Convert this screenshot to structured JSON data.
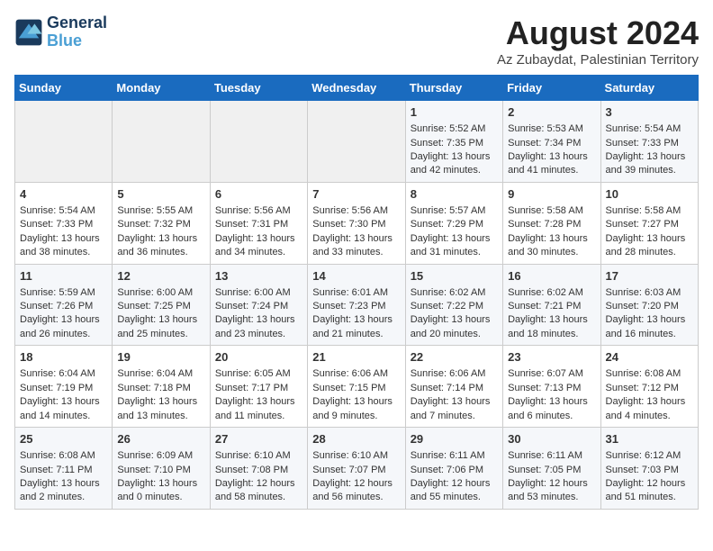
{
  "logo": {
    "line1": "General",
    "line2": "Blue"
  },
  "title": "August 2024",
  "subtitle": "Az Zubaydat, Palestinian Territory",
  "days_of_week": [
    "Sunday",
    "Monday",
    "Tuesday",
    "Wednesday",
    "Thursday",
    "Friday",
    "Saturday"
  ],
  "weeks": [
    [
      {
        "day": "",
        "content": ""
      },
      {
        "day": "",
        "content": ""
      },
      {
        "day": "",
        "content": ""
      },
      {
        "day": "",
        "content": ""
      },
      {
        "day": "1",
        "content": "Sunrise: 5:52 AM\nSunset: 7:35 PM\nDaylight: 13 hours\nand 42 minutes."
      },
      {
        "day": "2",
        "content": "Sunrise: 5:53 AM\nSunset: 7:34 PM\nDaylight: 13 hours\nand 41 minutes."
      },
      {
        "day": "3",
        "content": "Sunrise: 5:54 AM\nSunset: 7:33 PM\nDaylight: 13 hours\nand 39 minutes."
      }
    ],
    [
      {
        "day": "4",
        "content": "Sunrise: 5:54 AM\nSunset: 7:33 PM\nDaylight: 13 hours\nand 38 minutes."
      },
      {
        "day": "5",
        "content": "Sunrise: 5:55 AM\nSunset: 7:32 PM\nDaylight: 13 hours\nand 36 minutes."
      },
      {
        "day": "6",
        "content": "Sunrise: 5:56 AM\nSunset: 7:31 PM\nDaylight: 13 hours\nand 34 minutes."
      },
      {
        "day": "7",
        "content": "Sunrise: 5:56 AM\nSunset: 7:30 PM\nDaylight: 13 hours\nand 33 minutes."
      },
      {
        "day": "8",
        "content": "Sunrise: 5:57 AM\nSunset: 7:29 PM\nDaylight: 13 hours\nand 31 minutes."
      },
      {
        "day": "9",
        "content": "Sunrise: 5:58 AM\nSunset: 7:28 PM\nDaylight: 13 hours\nand 30 minutes."
      },
      {
        "day": "10",
        "content": "Sunrise: 5:58 AM\nSunset: 7:27 PM\nDaylight: 13 hours\nand 28 minutes."
      }
    ],
    [
      {
        "day": "11",
        "content": "Sunrise: 5:59 AM\nSunset: 7:26 PM\nDaylight: 13 hours\nand 26 minutes."
      },
      {
        "day": "12",
        "content": "Sunrise: 6:00 AM\nSunset: 7:25 PM\nDaylight: 13 hours\nand 25 minutes."
      },
      {
        "day": "13",
        "content": "Sunrise: 6:00 AM\nSunset: 7:24 PM\nDaylight: 13 hours\nand 23 minutes."
      },
      {
        "day": "14",
        "content": "Sunrise: 6:01 AM\nSunset: 7:23 PM\nDaylight: 13 hours\nand 21 minutes."
      },
      {
        "day": "15",
        "content": "Sunrise: 6:02 AM\nSunset: 7:22 PM\nDaylight: 13 hours\nand 20 minutes."
      },
      {
        "day": "16",
        "content": "Sunrise: 6:02 AM\nSunset: 7:21 PM\nDaylight: 13 hours\nand 18 minutes."
      },
      {
        "day": "17",
        "content": "Sunrise: 6:03 AM\nSunset: 7:20 PM\nDaylight: 13 hours\nand 16 minutes."
      }
    ],
    [
      {
        "day": "18",
        "content": "Sunrise: 6:04 AM\nSunset: 7:19 PM\nDaylight: 13 hours\nand 14 minutes."
      },
      {
        "day": "19",
        "content": "Sunrise: 6:04 AM\nSunset: 7:18 PM\nDaylight: 13 hours\nand 13 minutes."
      },
      {
        "day": "20",
        "content": "Sunrise: 6:05 AM\nSunset: 7:17 PM\nDaylight: 13 hours\nand 11 minutes."
      },
      {
        "day": "21",
        "content": "Sunrise: 6:06 AM\nSunset: 7:15 PM\nDaylight: 13 hours\nand 9 minutes."
      },
      {
        "day": "22",
        "content": "Sunrise: 6:06 AM\nSunset: 7:14 PM\nDaylight: 13 hours\nand 7 minutes."
      },
      {
        "day": "23",
        "content": "Sunrise: 6:07 AM\nSunset: 7:13 PM\nDaylight: 13 hours\nand 6 minutes."
      },
      {
        "day": "24",
        "content": "Sunrise: 6:08 AM\nSunset: 7:12 PM\nDaylight: 13 hours\nand 4 minutes."
      }
    ],
    [
      {
        "day": "25",
        "content": "Sunrise: 6:08 AM\nSunset: 7:11 PM\nDaylight: 13 hours\nand 2 minutes."
      },
      {
        "day": "26",
        "content": "Sunrise: 6:09 AM\nSunset: 7:10 PM\nDaylight: 13 hours\nand 0 minutes."
      },
      {
        "day": "27",
        "content": "Sunrise: 6:10 AM\nSunset: 7:08 PM\nDaylight: 12 hours\nand 58 minutes."
      },
      {
        "day": "28",
        "content": "Sunrise: 6:10 AM\nSunset: 7:07 PM\nDaylight: 12 hours\nand 56 minutes."
      },
      {
        "day": "29",
        "content": "Sunrise: 6:11 AM\nSunset: 7:06 PM\nDaylight: 12 hours\nand 55 minutes."
      },
      {
        "day": "30",
        "content": "Sunrise: 6:11 AM\nSunset: 7:05 PM\nDaylight: 12 hours\nand 53 minutes."
      },
      {
        "day": "31",
        "content": "Sunrise: 6:12 AM\nSunset: 7:03 PM\nDaylight: 12 hours\nand 51 minutes."
      }
    ]
  ]
}
